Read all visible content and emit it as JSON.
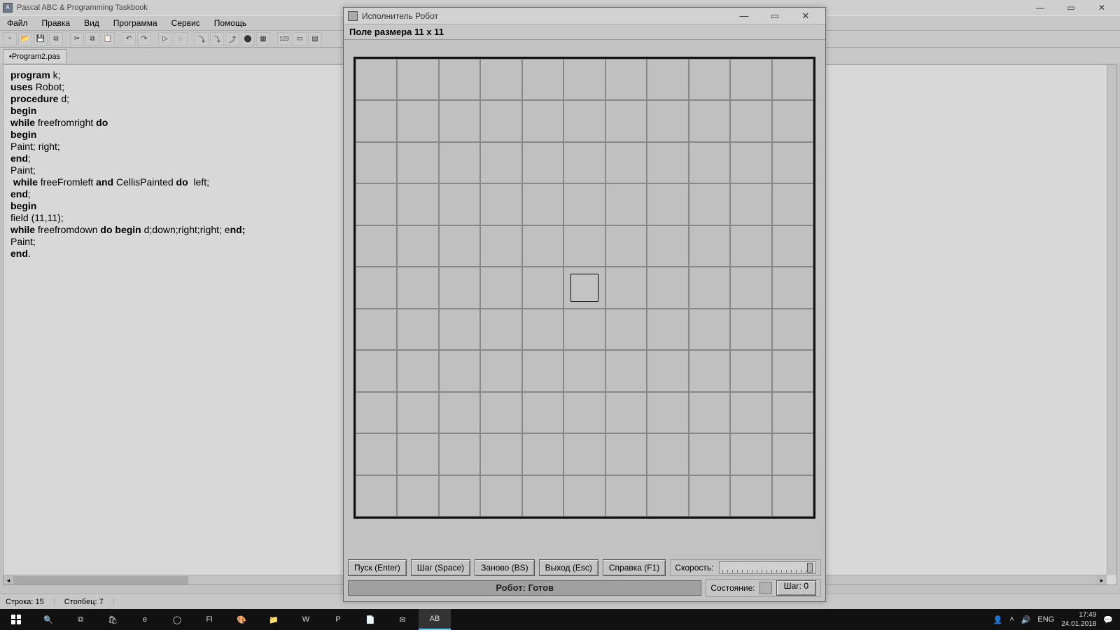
{
  "ide": {
    "title": "Pascal ABC & Programming Taskbook",
    "menu": [
      "Файл",
      "Правка",
      "Вид",
      "Программа",
      "Сервис",
      "Помощь"
    ],
    "tab": "•Program2.pas",
    "status": {
      "line": "Строка: 15",
      "col": "Столбец: 7"
    },
    "code_lines": [
      {
        "t": "program k;",
        "kw": [
          0,
          7
        ]
      },
      {
        "t": "uses Robot;",
        "kw": [
          0,
          4
        ]
      },
      {
        "t": "procedure d;",
        "kw": [
          0,
          9
        ]
      },
      {
        "t": "begin",
        "kw": [
          0,
          5
        ]
      },
      {
        "t": "while freefromright do",
        "kw_list": [
          [
            0,
            5
          ],
          [
            20,
            2
          ]
        ]
      },
      {
        "t": "begin",
        "kw": [
          0,
          5
        ]
      },
      {
        "t": "Paint; right;",
        "kw": null
      },
      {
        "t": "end;",
        "kw": [
          0,
          3
        ]
      },
      {
        "t": "Paint;",
        "kw": null
      },
      {
        "t": " while freeFromleft and CellisPainted do  left;",
        "kw_list": [
          [
            1,
            5
          ],
          [
            20,
            3
          ],
          [
            38,
            2
          ]
        ]
      },
      {
        "t": "end;",
        "kw": [
          0,
          3
        ]
      },
      {
        "t": "begin",
        "kw": [
          0,
          5
        ]
      },
      {
        "t": "field (11,11);",
        "kw": null
      },
      {
        "t": "while freefromdown do begin d;down;right;right; end;",
        "kw_list": [
          [
            0,
            5
          ],
          [
            19,
            2
          ],
          [
            22,
            5
          ],
          [
            49,
            3
          ]
        ]
      },
      {
        "t": "Paint;",
        "kw": null
      },
      {
        "t": "end.",
        "kw": [
          0,
          3
        ]
      }
    ]
  },
  "robot": {
    "title": "Исполнитель Робот",
    "subtitle": "Поле размера 11 x 11",
    "grid": {
      "rows": 11,
      "cols": 11,
      "robot_pos": {
        "r": 5,
        "c": 5
      }
    },
    "buttons": [
      "Пуск (Enter)",
      "Шаг (Space)",
      "Заново (BS)",
      "Выход (Esc)",
      "Справка (F1)"
    ],
    "speed_label": "Скорость:",
    "status_msg": "Робот: Готов",
    "state_label": "Состояние:",
    "step_label": "Шаг: 0"
  },
  "taskbar": {
    "lang": "ENG",
    "time": "17:49",
    "date": "24.01.2018"
  }
}
